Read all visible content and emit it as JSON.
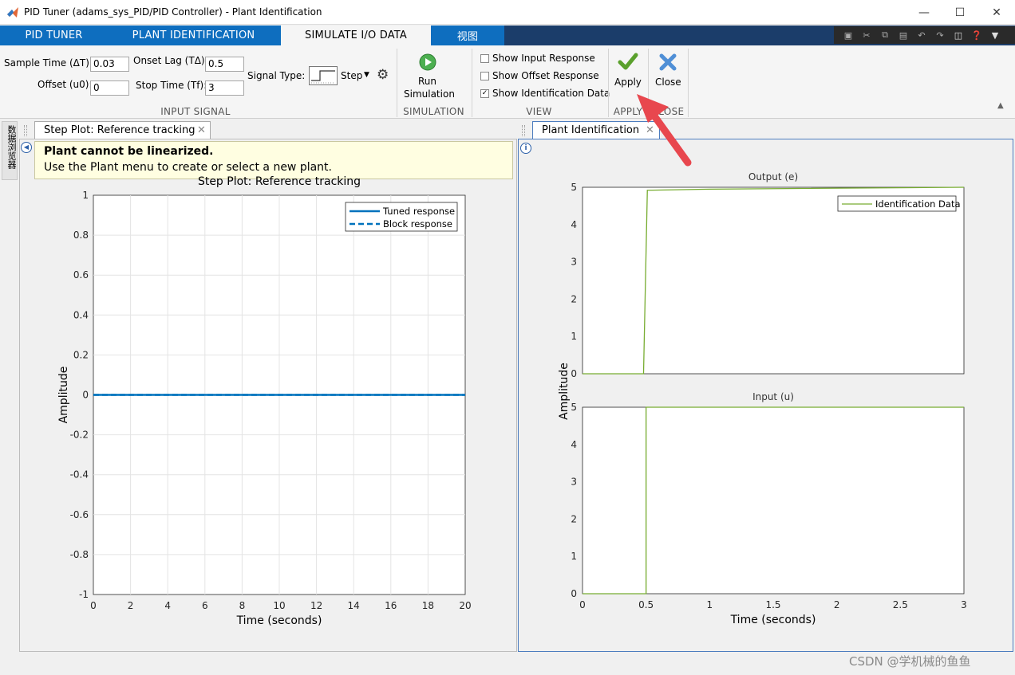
{
  "window": {
    "title": "PID Tuner (adams_sys_PID/PID Controller) - Plant Identification"
  },
  "tabs": [
    {
      "label": "PID TUNER"
    },
    {
      "label": "PLANT IDENTIFICATION"
    },
    {
      "label": "SIMULATE I/O DATA"
    },
    {
      "label": "视图"
    }
  ],
  "input_signal": {
    "sample_time_label": "Sample Time (ΔT):",
    "sample_time_value": "0.03",
    "onset_lag_label": "Onset Lag (TΔ):",
    "onset_lag_value": "0.5",
    "offset_label": "Offset (u0):",
    "offset_value": "0",
    "stop_time_label": "Stop Time (Tf):",
    "stop_time_value": "3",
    "signal_type_label": "Signal Type:",
    "signal_type_value": "Step",
    "section_label": "INPUT SIGNAL"
  },
  "simulation": {
    "run_label_1": "Run",
    "run_label_2": "Simulation",
    "section_label": "SIMULATION"
  },
  "view": {
    "show_input_response": "Show Input Response",
    "show_offset_response": "Show Offset Response",
    "show_identification_data": "Show Identification Data",
    "show_input_checked": false,
    "show_offset_checked": false,
    "show_ident_checked": true,
    "section_label": "VIEW"
  },
  "apply_section": {
    "apply_label": "Apply",
    "section_label": "APPLY"
  },
  "close_section": {
    "close_label": "Close",
    "section_label": "CLOSE"
  },
  "side_tab": {
    "label": "数据浏览器"
  },
  "left_panel": {
    "tab_label": "Step Plot: Reference tracking",
    "message_title": "Plant cannot be linearized.",
    "message_body": "Use the Plant menu to create or select a new plant."
  },
  "right_panel": {
    "tab_label": "Plant Identification"
  },
  "watermark": "CSDN @学机械的鱼鱼",
  "colors": {
    "accent_blue": "#0e6ebf",
    "tuned_line": "#0072bd",
    "ident_line": "#77ac30",
    "arrow": "#e8474e"
  },
  "chart_data": [
    {
      "type": "line",
      "title": "Step Plot: Reference tracking",
      "xlabel": "Time (seconds)",
      "ylabel": "Amplitude",
      "xlim": [
        0,
        20
      ],
      "ylim": [
        -1,
        1
      ],
      "xticks": [
        "0",
        "2",
        "4",
        "6",
        "8",
        "10",
        "12",
        "14",
        "16",
        "18",
        "20"
      ],
      "yticks": [
        "1",
        "0.8",
        "0.6",
        "0.4",
        "0.2",
        "0",
        "-0.2",
        "-0.4",
        "-0.6",
        "-0.8",
        "-1"
      ],
      "grid": true,
      "legend_position": "top-right",
      "series": [
        {
          "name": "Tuned response",
          "style": "solid",
          "x": [
            0,
            20
          ],
          "y": [
            0,
            0
          ]
        },
        {
          "name": "Block response",
          "style": "dashed",
          "x": [
            0,
            20
          ],
          "y": [
            0,
            0
          ]
        }
      ]
    },
    {
      "type": "line",
      "title": "Output (e)",
      "ylabel": "Amplitude",
      "xlim": [
        0,
        3
      ],
      "ylim": [
        0,
        5
      ],
      "yticks": [
        "5",
        "4",
        "3",
        "2",
        "1",
        "0"
      ],
      "grid": false,
      "legend_position": "top-right",
      "series": [
        {
          "name": "Identification Data",
          "x": [
            0,
            0.48,
            0.51,
            1.0,
            3.0
          ],
          "y": [
            0,
            0,
            4.92,
            4.95,
            5.0
          ]
        }
      ]
    },
    {
      "type": "line",
      "title": "Input (u)",
      "xlabel": "Time (seconds)",
      "xlim": [
        0,
        3
      ],
      "ylim": [
        0,
        5
      ],
      "xticks": [
        "0",
        "0.5",
        "1",
        "1.5",
        "2",
        "2.5",
        "3"
      ],
      "yticks": [
        "5",
        "4",
        "3",
        "2",
        "1",
        "0"
      ],
      "grid": false,
      "series": [
        {
          "name": "Identification Data",
          "x": [
            0,
            0.5,
            0.5,
            3.0
          ],
          "y": [
            0,
            0,
            5,
            5
          ]
        }
      ]
    }
  ]
}
